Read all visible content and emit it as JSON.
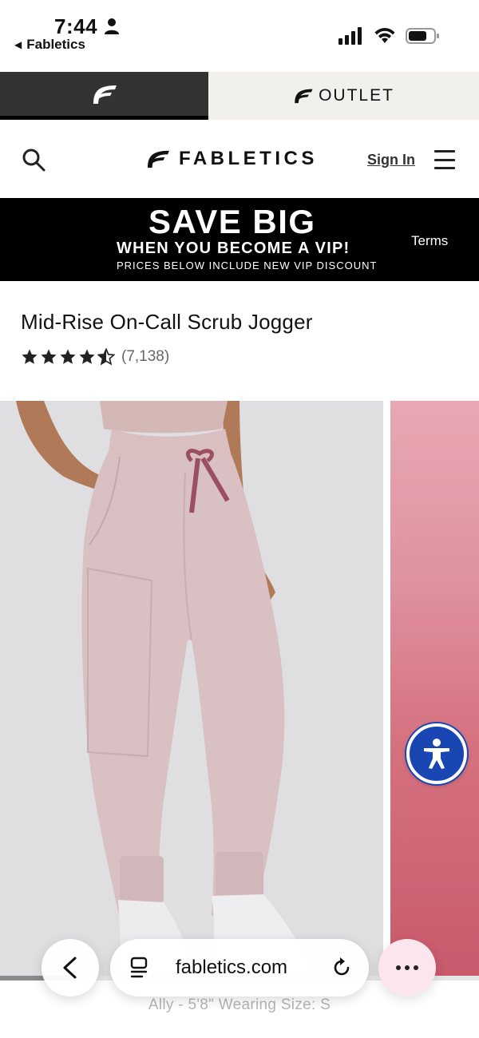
{
  "status_bar": {
    "time": "7:44",
    "back_app": "Fabletics"
  },
  "brand_tabs": {
    "outlet_label": "OUTLET"
  },
  "header": {
    "logo_text": "FABLETICS",
    "sign_in": "Sign In"
  },
  "promo": {
    "headline": "SAVE BIG",
    "subheadline": "WHEN YOU BECOME A VIP!",
    "note": "PRICES BELOW INCLUDE NEW VIP DISCOUNT",
    "terms": "Terms"
  },
  "product": {
    "title": "Mid-Rise On-Call Scrub Jogger",
    "rating_stars": 4.5,
    "review_count": "(7,138)",
    "model_caption": "Ally - 5'8\" Wearing Size: S"
  },
  "browser": {
    "url": "fabletics.com"
  },
  "colors": {
    "accessibility_blue": "#1a46b3",
    "promo_black": "#000000",
    "product_pink": "#d8c0c3"
  }
}
